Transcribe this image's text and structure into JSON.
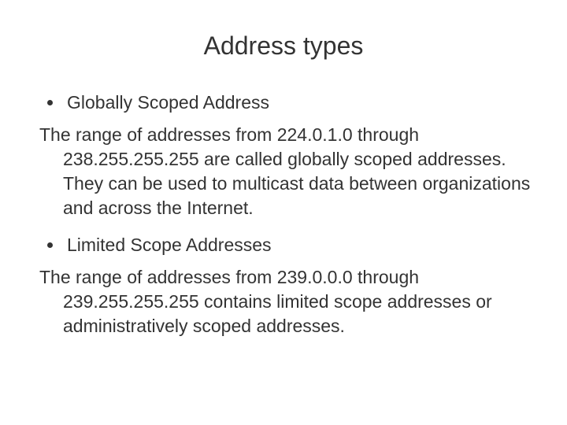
{
  "slide": {
    "title": "Address types",
    "sections": [
      {
        "bullet": "Globally Scoped Address",
        "paragraph": "The range of addresses from 224.0.1.0 through 238.255.255.255 are called globally scoped addresses. They can be used to multicast data between organizations and across the Internet."
      },
      {
        "bullet": "Limited Scope Addresses",
        "paragraph": "The range of addresses from 239.0.0.0 through 239.255.255.255 contains limited scope addresses or administratively scoped addresses."
      }
    ]
  }
}
